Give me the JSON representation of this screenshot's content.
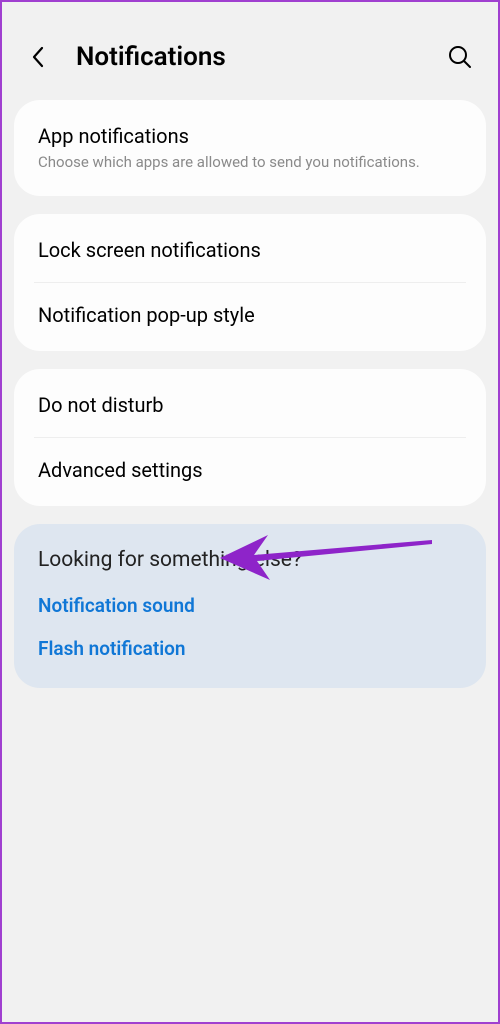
{
  "header": {
    "title": "Notifications"
  },
  "section1": {
    "app_notifications": {
      "title": "App notifications",
      "desc": "Choose which apps are allowed to send you notifications."
    }
  },
  "section2": {
    "lock_screen": "Lock screen notifications",
    "popup_style": "Notification pop-up style"
  },
  "section3": {
    "dnd": "Do not disturb",
    "advanced": "Advanced settings"
  },
  "looking": {
    "title": "Looking for something else?",
    "link1": "Notification sound",
    "link2": "Flash notification"
  }
}
